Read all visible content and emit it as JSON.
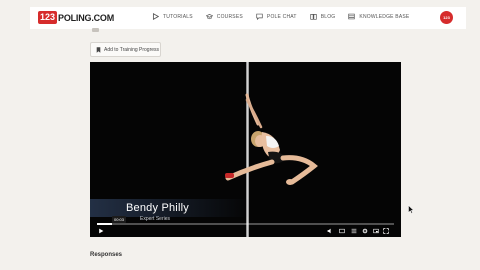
{
  "brand": {
    "badge": "123",
    "name": "POLING.COM",
    "accent": "#d62c2c"
  },
  "nav": {
    "items": [
      {
        "label": "TUTORIALS",
        "icon": "play-icon"
      },
      {
        "label": "COURSES",
        "icon": "graduation-cap-icon"
      },
      {
        "label": "POLE CHAT",
        "icon": "chat-icon"
      },
      {
        "label": "BLOG",
        "icon": "book-icon"
      },
      {
        "label": "KNOWLEDGE BASE",
        "icon": "library-icon"
      }
    ]
  },
  "user": {
    "avatar_label": "123"
  },
  "page": {
    "training_button": "Add to Training Progress",
    "responses_heading": "Responses"
  },
  "video": {
    "caption_name": "Bendy Philly",
    "caption_sub": "Expert Series",
    "hover_time": "00:03",
    "progress": 0.05
  }
}
